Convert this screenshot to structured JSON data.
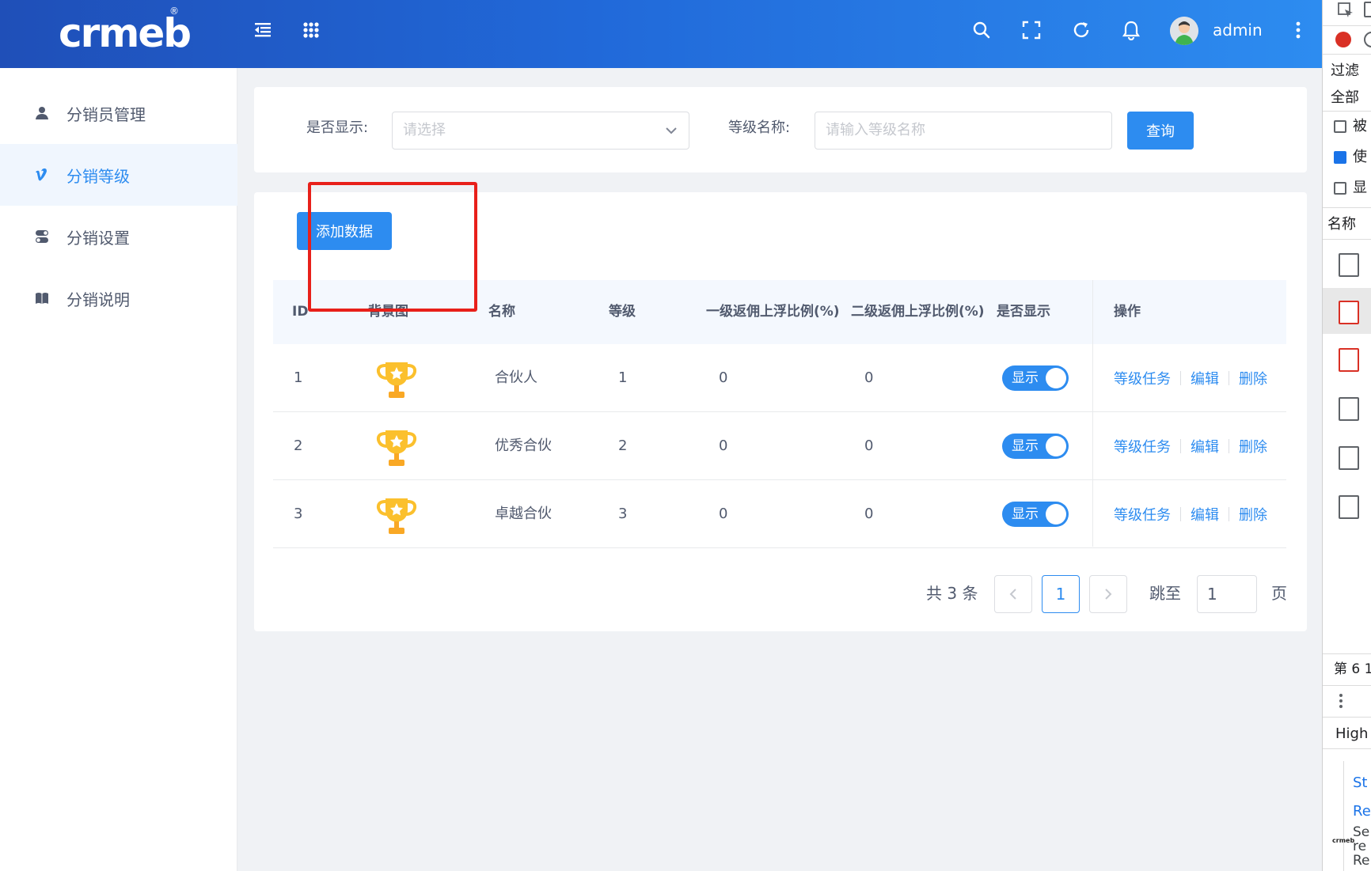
{
  "header": {
    "logo_text": "crmeb",
    "logo_registered": "®",
    "user_name": "admin",
    "icons": [
      "menu-fold-icon",
      "apps-grid-icon",
      "search-icon",
      "fullscreen-icon",
      "refresh-icon",
      "bell-icon",
      "more-vertical-icon"
    ]
  },
  "sidebar": {
    "items": [
      {
        "label": "分销员管理",
        "icon": "user-icon"
      },
      {
        "label": "分销等级",
        "icon": "vimeo-v-icon",
        "active": true
      },
      {
        "label": "分销设置",
        "icon": "toggle-icon"
      },
      {
        "label": "分销说明",
        "icon": "book-icon"
      }
    ]
  },
  "filter": {
    "show_label": "是否显示:",
    "show_placeholder": "请选择",
    "name_label": "等级名称:",
    "name_placeholder": "请输入等级名称",
    "query_button": "查询"
  },
  "toolbar": {
    "add_button": "添加数据"
  },
  "table": {
    "headers": [
      "ID",
      "背景图",
      "名称",
      "等级",
      "一级返佣上浮比例(%)",
      "二级返佣上浮比例(%)",
      "是否显示",
      "操作"
    ],
    "rows": [
      {
        "id": "1",
        "name": "合伙人",
        "level": "1",
        "rate1": "0",
        "rate2": "0",
        "show": "显示"
      },
      {
        "id": "2",
        "name": "优秀合伙",
        "level": "2",
        "rate1": "0",
        "rate2": "0",
        "show": "显示"
      },
      {
        "id": "3",
        "name": "卓越合伙",
        "level": "3",
        "rate1": "0",
        "rate2": "0",
        "show": "显示"
      }
    ],
    "actions": {
      "task": "等级任务",
      "edit": "编辑",
      "delete": "删除"
    }
  },
  "pagination": {
    "total_text": "共 3 条",
    "current_page": "1",
    "jump_label": "跳至",
    "jump_value": "1",
    "page_suffix": "页"
  },
  "devtools": {
    "filter_label": "过滤",
    "all_label": "全部",
    "check1": "被",
    "check2": "使",
    "check3": "显",
    "name_header": "名称",
    "footer_text": "第 6 1",
    "highlight_text": "High",
    "link1": "St",
    "link2": "Re",
    "text1": "Se",
    "text2": "re",
    "text3": "Re"
  },
  "colors": {
    "primary": "#2d8cf0",
    "header_start": "#1f4fb8",
    "header_end": "#2d8cf0",
    "annotation_red": "#e8201a"
  }
}
